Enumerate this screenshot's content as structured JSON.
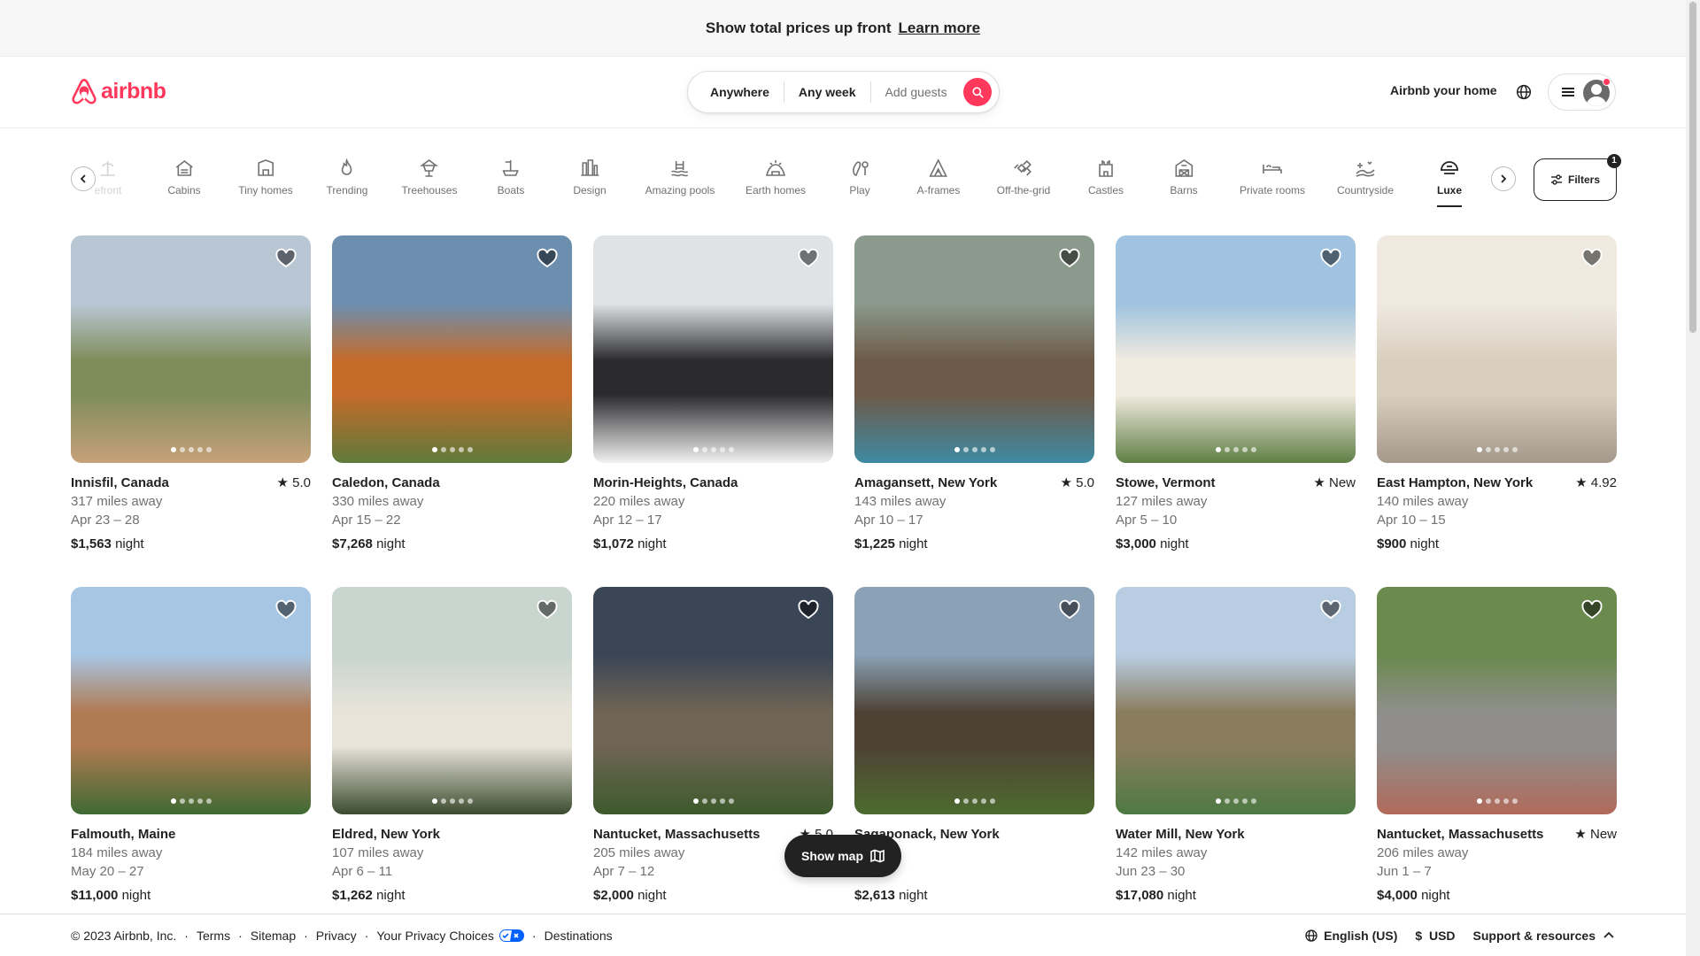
{
  "banner": {
    "text": "Show total prices up front",
    "link": "Learn more"
  },
  "header": {
    "logo": "airbnb",
    "search": {
      "where": "Anywhere",
      "when": "Any week",
      "who": "Add guests"
    },
    "host_link": "Airbnb your home"
  },
  "categories": [
    {
      "label": "efront",
      "icon": "beach-icon"
    },
    {
      "label": "Cabins",
      "icon": "cabin-icon"
    },
    {
      "label": "Tiny homes",
      "icon": "tiny-home-icon"
    },
    {
      "label": "Trending",
      "icon": "fire-icon"
    },
    {
      "label": "Treehouses",
      "icon": "treehouse-icon"
    },
    {
      "label": "Boats",
      "icon": "boat-icon"
    },
    {
      "label": "Design",
      "icon": "design-icon"
    },
    {
      "label": "Amazing pools",
      "icon": "pool-icon"
    },
    {
      "label": "Earth homes",
      "icon": "earth-home-icon"
    },
    {
      "label": "Play",
      "icon": "play-icon"
    },
    {
      "label": "A-frames",
      "icon": "a-frame-icon"
    },
    {
      "label": "Off-the-grid",
      "icon": "off-grid-icon"
    },
    {
      "label": "Castles",
      "icon": "castle-icon"
    },
    {
      "label": "Barns",
      "icon": "barn-icon"
    },
    {
      "label": "Private rooms",
      "icon": "bed-icon"
    },
    {
      "label": "Countryside",
      "icon": "countryside-icon"
    },
    {
      "label": "Luxe",
      "icon": "luxe-icon"
    }
  ],
  "filters": {
    "label": "Filters",
    "count": "1"
  },
  "listings": [
    {
      "location": "Innisfil, Canada",
      "distance": "317 miles away",
      "dates": "Apr 23 – 28",
      "price": "$1,563",
      "unit": "night",
      "rating": "5.0",
      "colors": [
        "#b9c7d4",
        "#7f8d5c",
        "#c7a17a"
      ]
    },
    {
      "location": "Caledon, Canada",
      "distance": "330 miles away",
      "dates": "Apr 15 – 22",
      "price": "$7,268",
      "unit": "night",
      "rating": "",
      "colors": [
        "#6c8fb0",
        "#c46b2a",
        "#5f7a3b"
      ]
    },
    {
      "location": "Morin-Heights, Canada",
      "distance": "220 miles away",
      "dates": "Apr 12 – 17",
      "price": "$1,072",
      "unit": "night",
      "rating": "",
      "colors": [
        "#dfe3e6",
        "#2b2b2e",
        "#f2f2f2"
      ]
    },
    {
      "location": "Amagansett, New York",
      "distance": "143 miles away",
      "dates": "Apr 10 – 17",
      "price": "$1,225",
      "unit": "night",
      "rating": "5.0",
      "colors": [
        "#8a9a8c",
        "#6e5a49",
        "#3e8aa2"
      ]
    },
    {
      "location": "Stowe, Vermont",
      "distance": "127 miles away",
      "dates": "Apr 5 – 10",
      "price": "$3,000",
      "unit": "night",
      "rating": "New",
      "colors": [
        "#9fc3e0",
        "#f1ece0",
        "#5f7f45"
      ]
    },
    {
      "location": "East Hampton, New York",
      "distance": "140 miles away",
      "dates": "Apr 10 – 15",
      "price": "$900",
      "unit": "night",
      "rating": "4.92",
      "colors": [
        "#efe9e0",
        "#d9cfbf",
        "#a3988a"
      ]
    },
    {
      "location": "Falmouth, Maine",
      "distance": "184 miles away",
      "dates": "May 20 – 27",
      "price": "$11,000",
      "unit": "night",
      "rating": "",
      "colors": [
        "#a7c6e3",
        "#b07a52",
        "#3f6a33"
      ]
    },
    {
      "location": "Eldred, New York",
      "distance": "107 miles away",
      "dates": "Apr 6 – 11",
      "price": "$1,262",
      "unit": "night",
      "rating": "",
      "colors": [
        "#c9d5cf",
        "#e8e4da",
        "#3b4b2f"
      ]
    },
    {
      "location": "Nantucket, Massachusetts",
      "distance": "205 miles away",
      "dates": "Apr 7 – 12",
      "price": "$2,000",
      "unit": "night",
      "rating": "5.0",
      "colors": [
        "#3a4656",
        "#6f6555",
        "#3d5a2c"
      ]
    },
    {
      "location": "Sagaponack, New York",
      "distance": "s away",
      "dates": "10",
      "price": "$2,613",
      "unit": "night",
      "rating": "",
      "colors": [
        "#8aa1b6",
        "#4e4235",
        "#4d6b2f"
      ]
    },
    {
      "location": "Water Mill, New York",
      "distance": "142 miles away",
      "dates": "Jun 23 – 30",
      "price": "$17,080",
      "unit": "night",
      "rating": "",
      "colors": [
        "#b8cde2",
        "#8a7d5e",
        "#4d7a43"
      ]
    },
    {
      "location": "Nantucket, Massachusetts",
      "distance": "206 miles away",
      "dates": "Jun 1 – 7",
      "price": "$4,000",
      "unit": "night",
      "rating": "New",
      "colors": [
        "#6b8a4e",
        "#8f8e8c",
        "#b16a5a"
      ]
    }
  ],
  "show_map": "Show map",
  "footer": {
    "copyright": "© 2023 Airbnb, Inc.",
    "links": [
      "Terms",
      "Sitemap",
      "Privacy",
      "Your Privacy Choices",
      "Destinations"
    ],
    "language": "English (US)",
    "currency_symbol": "$",
    "currency": "USD",
    "support": "Support & resources"
  },
  "colors": {
    "brand": "#ff385c",
    "text": "#222222",
    "muted": "#717171"
  }
}
